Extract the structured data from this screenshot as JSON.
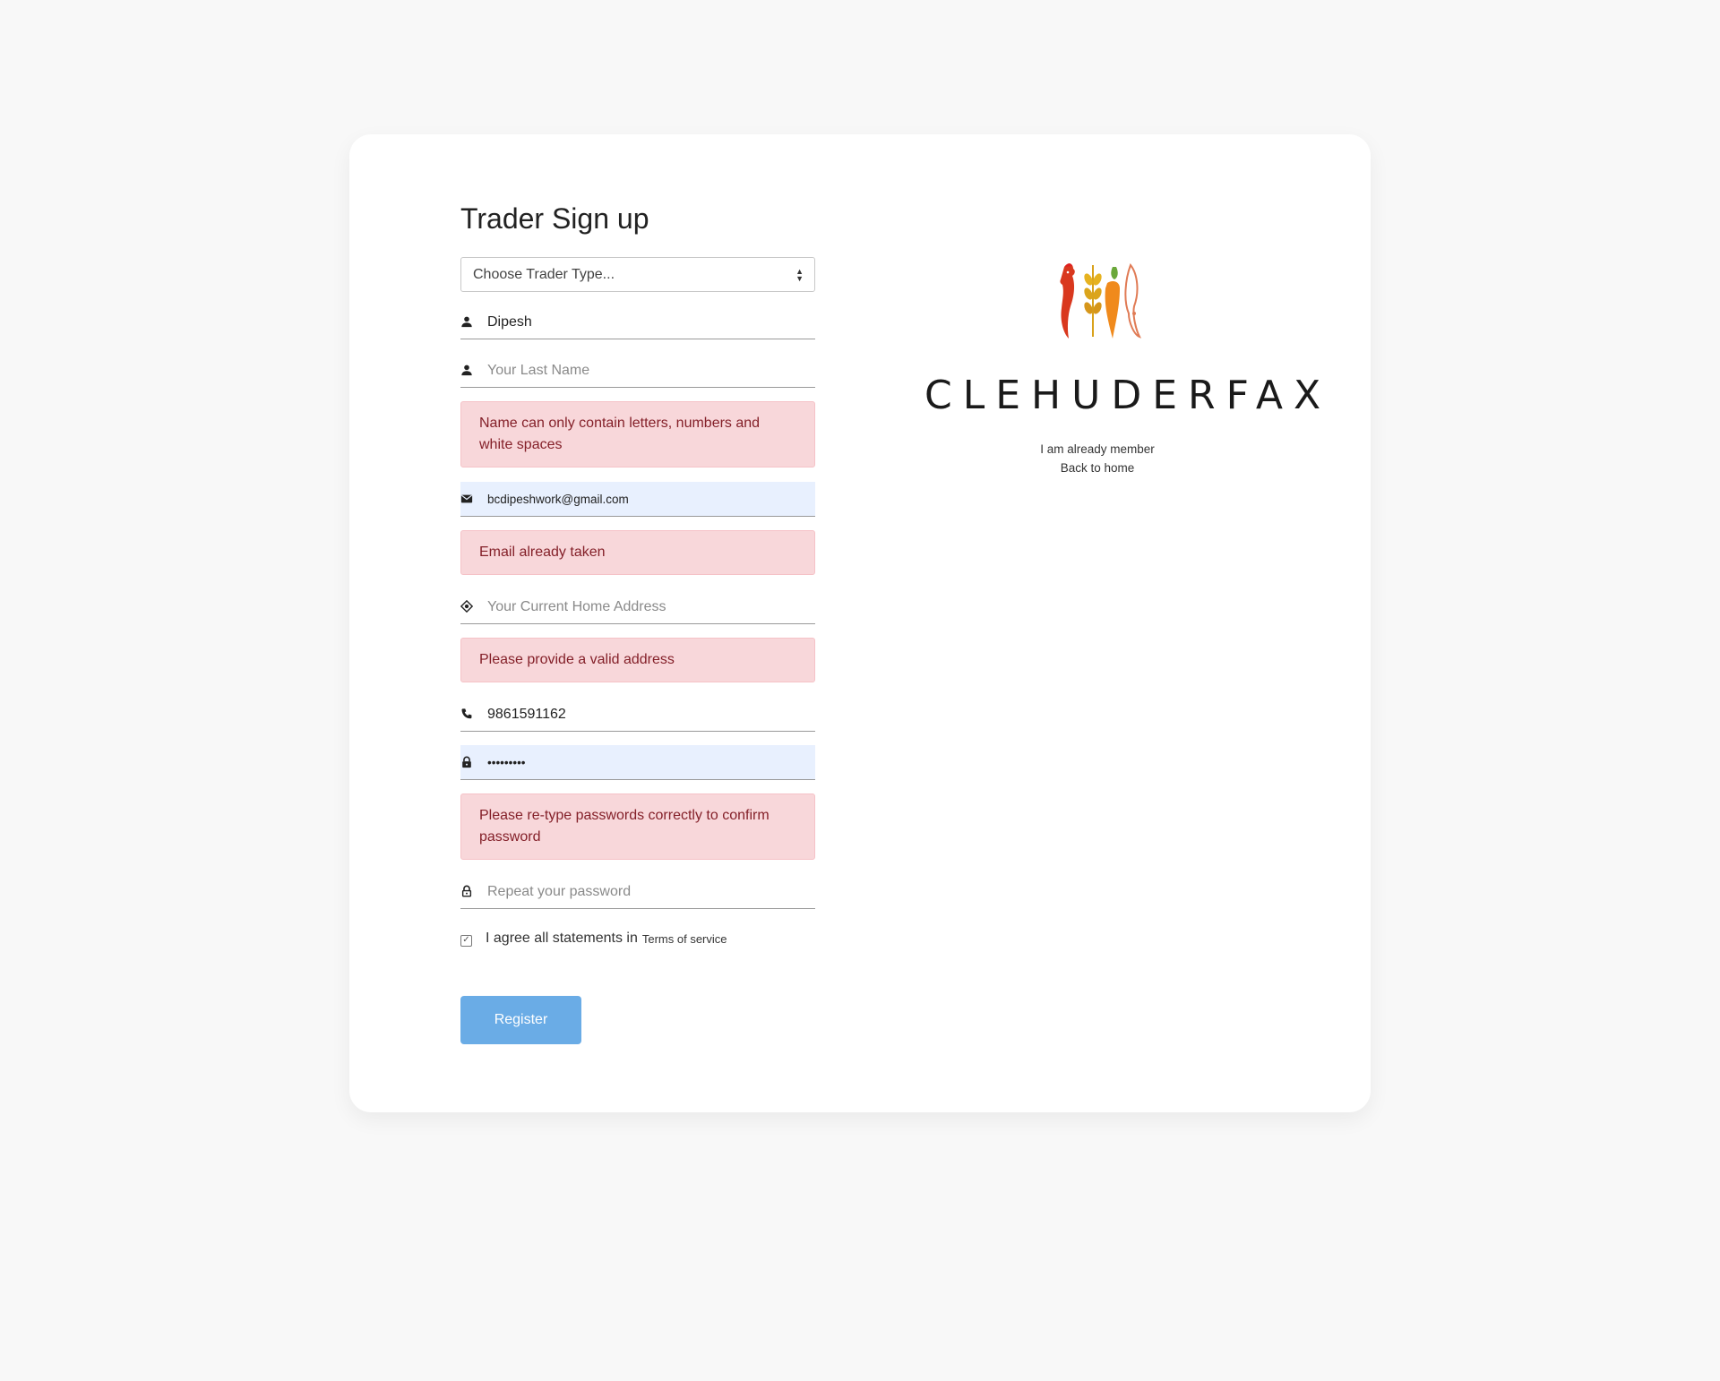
{
  "form": {
    "title": "Trader Sign up",
    "trader_type": {
      "value": "Choose Trader Type..."
    },
    "first_name": {
      "value": "Dipesh"
    },
    "last_name": {
      "placeholder": "Your Last Name"
    },
    "name_error": "Name can only contain letters, numbers and white spaces",
    "email": {
      "value": "bcdipeshwork@gmail.com"
    },
    "email_error": "Email already taken",
    "address": {
      "placeholder": "Your Current Home Address"
    },
    "address_error": "Please provide a valid address",
    "phone": {
      "value": "9861591162"
    },
    "password": {
      "value": "•••••••••"
    },
    "password_error": "Please re-type passwords correctly to confirm password",
    "repeat_password": {
      "placeholder": "Repeat your password"
    },
    "terms_label": "I agree all statements in",
    "terms_link": "Terms of service",
    "terms_checked": true,
    "register_label": "Register"
  },
  "brand": {
    "name": "CLEHUDERFAX",
    "logo_icon": "rooster-wheat-carrot-fish-logo",
    "links": {
      "member": "I am already member",
      "home": "Back to home"
    }
  },
  "colors": {
    "page_bg": "#f8f8f8",
    "card_bg": "#ffffff",
    "alert_bg": "#f8d7da",
    "alert_text": "#842029",
    "autofill_bg": "#e8f0fe",
    "button_bg": "#6aace6"
  }
}
